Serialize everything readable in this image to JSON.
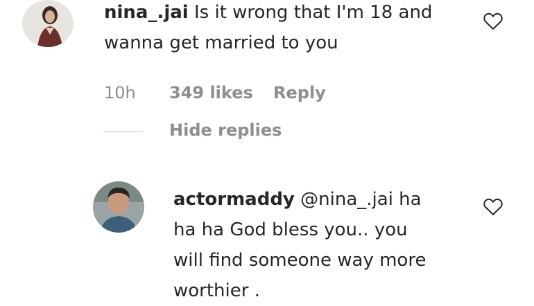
{
  "comment": {
    "username": "nina_.jai",
    "text_line1": "Is it wrong that I'm 18 and",
    "text_line2": "wanna get married to you",
    "time": "10h",
    "likes": "349 likes",
    "reply_label": "Reply"
  },
  "hide_replies_label": "Hide replies",
  "reply": {
    "username": "actormaddy",
    "text_line1": "@nina_.jai ha",
    "text_line2": "ha ha God bless you.. you",
    "text_line3": "will find someone way more",
    "text_line4": "worthier ."
  },
  "colors": {
    "text": "#262626",
    "secondary": "#8e8e8e",
    "divider": "#c7c7c7"
  },
  "icons": {
    "like": "heart-outline-icon"
  }
}
